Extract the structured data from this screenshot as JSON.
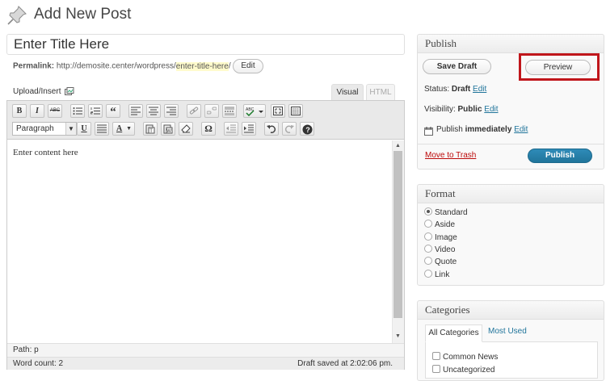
{
  "header": {
    "title": "Add New Post",
    "icon": "pushpin-icon"
  },
  "title_field": {
    "value": "Enter Title Here"
  },
  "permalink": {
    "label": "Permalink:",
    "base": "http://demosite.center/wordpress/",
    "slug": "enter-title-here",
    "trailing": "/",
    "edit_label": "Edit"
  },
  "editor": {
    "upload_label": "Upload/Insert",
    "tabs": {
      "visual": "Visual",
      "html": "HTML"
    },
    "toolbar": {
      "format_select": "Paragraph",
      "bold": "B",
      "italic": "I",
      "strike": "ABC",
      "quote": "“",
      "underline": "U",
      "text_color": "A",
      "omega": "Ω",
      "help": "?"
    },
    "content": "Enter content here",
    "path_label": "Path:",
    "path_value": "p",
    "word_count": "Word count: 2",
    "draft_saved": "Draft saved at 2:02:06 pm."
  },
  "publish_box": {
    "title": "Publish",
    "save_draft": "Save Draft",
    "preview": "Preview",
    "status_label": "Status:",
    "status_value": "Draft",
    "visibility_label": "Visibility:",
    "visibility_value": "Public",
    "publish_label": "Publish",
    "publish_value": "immediately",
    "edit": "Edit",
    "trash": "Move to Trash",
    "publish_button": "Publish",
    "highlight_color": "#c0161b",
    "publish_color": "#21759b"
  },
  "format_box": {
    "title": "Format",
    "options": [
      "Standard",
      "Aside",
      "Image",
      "Video",
      "Quote",
      "Link"
    ],
    "selected": "Standard"
  },
  "categories_box": {
    "title": "Categories",
    "tabs": {
      "all": "All Categories",
      "used": "Most Used"
    },
    "items": [
      "Common News",
      "Uncategorized"
    ]
  }
}
